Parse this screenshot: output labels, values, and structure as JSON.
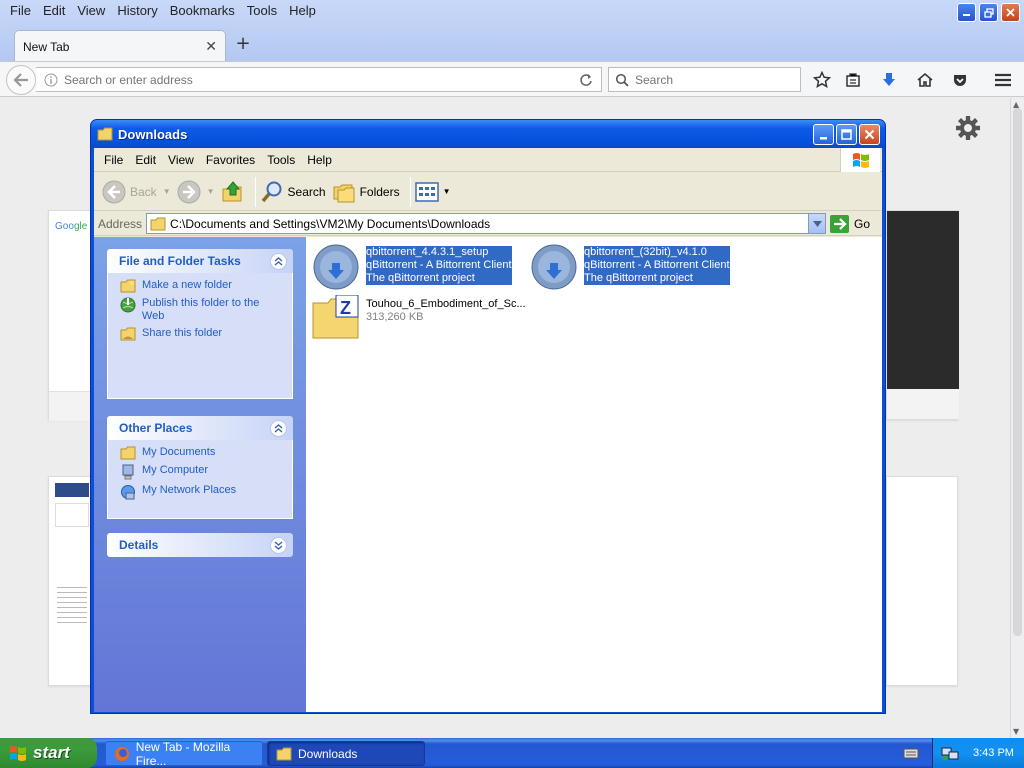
{
  "firefox": {
    "menu": [
      "File",
      "Edit",
      "View",
      "History",
      "Bookmarks",
      "Tools",
      "Help"
    ],
    "tab_title": "New Tab",
    "address_placeholder": "Search or enter address",
    "search_placeholder": "Search"
  },
  "explorer": {
    "title": "Downloads",
    "menu": [
      "File",
      "Edit",
      "View",
      "Favorites",
      "Tools",
      "Help"
    ],
    "toolbar": {
      "back": "Back",
      "search": "Search",
      "folders": "Folders"
    },
    "address_label": "Address",
    "address_value": "C:\\Documents and Settings\\VM2\\My Documents\\Downloads",
    "go_label": "Go",
    "file_tasks": {
      "title": "File and Folder Tasks",
      "items": [
        "Make a new folder",
        "Publish this folder to the Web",
        "Share this folder"
      ]
    },
    "other_places": {
      "title": "Other Places",
      "items": [
        "My Documents",
        "My Computer",
        "My Network Places"
      ]
    },
    "details_title": "Details",
    "files": [
      {
        "name": "qbittorrent_4.4.3.1_setup",
        "line2": "qBittorrent - A Bittorrent Client",
        "line3": "The qBittorrent project"
      },
      {
        "name": "qbittorrent_(32bit)_v4.1.0",
        "line2": "qBittorrent - A Bittorrent Client",
        "line3": "The qBittorrent project"
      },
      {
        "name": "Touhou_6_Embodiment_of_Sc...",
        "line2": "313,260 KB"
      }
    ]
  },
  "taskbar": {
    "start": "start",
    "buttons": [
      "New Tab - Mozilla Fire...",
      "Downloads"
    ],
    "clock": "3:43 PM"
  }
}
